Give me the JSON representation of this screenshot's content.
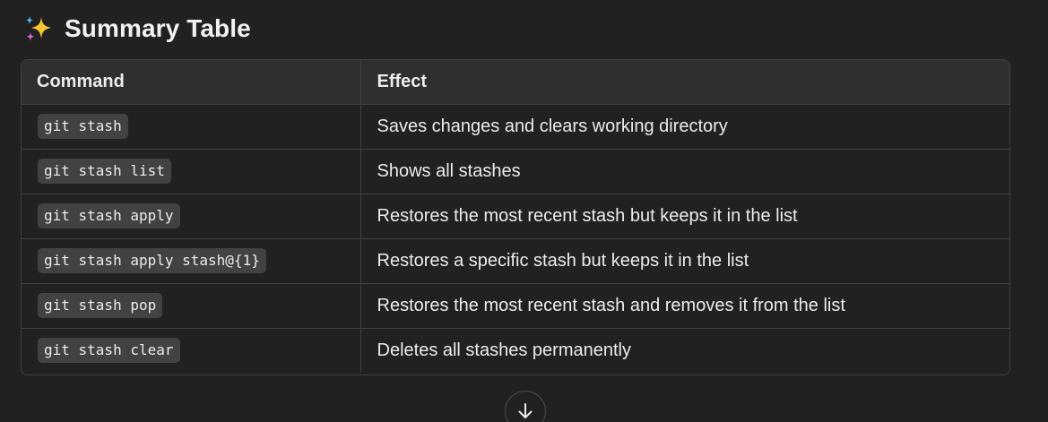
{
  "heading": {
    "emoji_icon": "sparkles-icon",
    "title": "Summary Table"
  },
  "table": {
    "headers": [
      "Command",
      "Effect"
    ],
    "rows": [
      {
        "command": "git stash",
        "effect": "Saves changes and clears working directory"
      },
      {
        "command": "git stash list",
        "effect": "Shows all stashes"
      },
      {
        "command": "git stash apply",
        "effect": "Restores the most recent stash but keeps it in the list"
      },
      {
        "command": "git stash apply stash@{1}",
        "effect": "Restores a specific stash but keeps it in the list"
      },
      {
        "command": "git stash pop",
        "effect": "Restores the most recent stash and removes it from the list"
      },
      {
        "command": "git stash clear",
        "effect": "Deletes all stashes permanently"
      }
    ]
  },
  "scroll_button": {
    "icon": "arrow-down-icon"
  },
  "colors": {
    "background": "#212121",
    "header_row": "#2f2f2f",
    "border": "#3f3f3f",
    "code_bg": "#424242",
    "text": "#ececec",
    "sparkle_yellow": "#f7c531"
  }
}
